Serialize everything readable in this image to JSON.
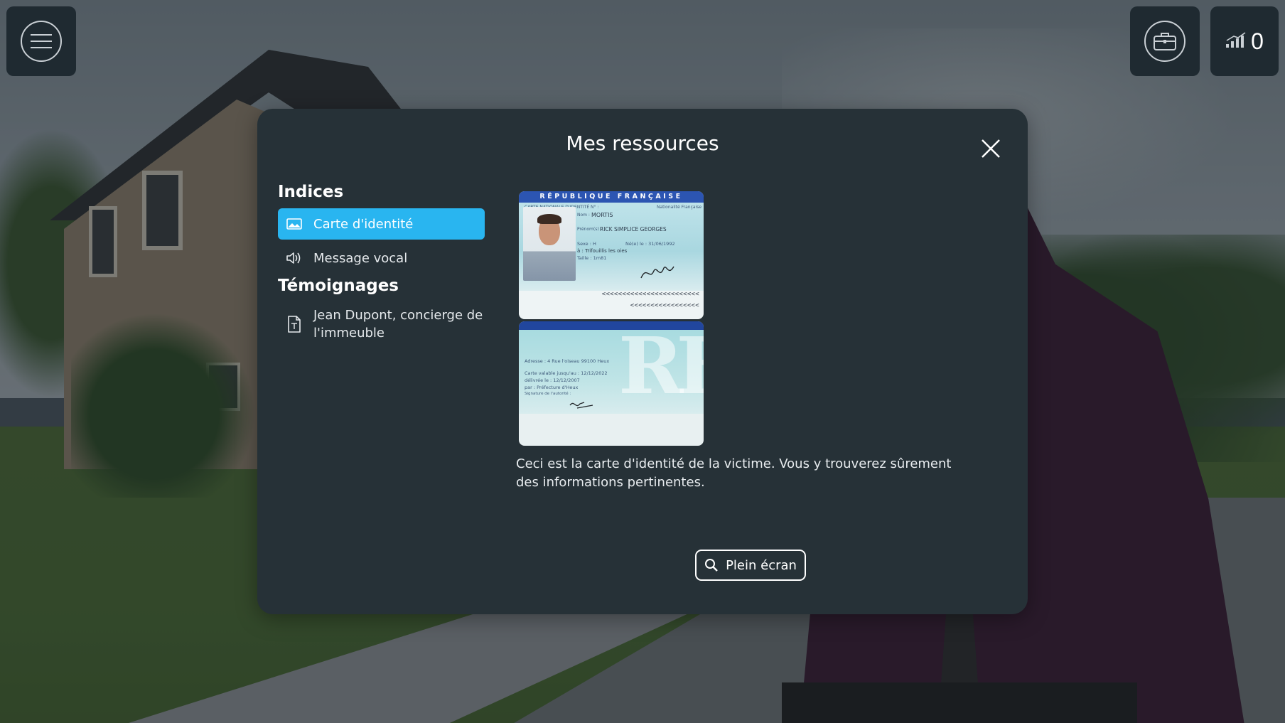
{
  "hud": {
    "score": "0"
  },
  "modal": {
    "title": "Mes ressources",
    "sections": {
      "indices": {
        "title": "Indices",
        "items": [
          {
            "label": "Carte d'identité",
            "icon": "image-icon"
          },
          {
            "label": "Message vocal",
            "icon": "speaker-icon"
          }
        ]
      },
      "temoignages": {
        "title": "Témoignages",
        "items": [
          {
            "label": "Jean Dupont, concierge de l'immeuble",
            "icon": "document-icon"
          }
        ]
      }
    },
    "card": {
      "front": {
        "header": "RÉPUBLIQUE FRANÇAISE",
        "subheader": "CARTE NATIONALE D'IDENTITÉ N° :",
        "nationality": "Nationalité Française",
        "nom_label": "Nom :",
        "nom": "MORTIS",
        "prenoms_label": "Prénom(s) :",
        "prenoms": "RICK SIMPLICE GEORGES",
        "sexe_label": "Sexe : H",
        "ne_label": "Né(e) le : 31/06/1992",
        "lieu": "à : Trifouillis les oies",
        "taille": "Taille : 1m81",
        "mrz1": "<<<<<<<<<<<<<<<<<<<<<<<<",
        "mrz2": "<<<<<<<<<<<<<<<<<"
      },
      "back": {
        "adresse": "Adresse : 4 Rue l'oiseau 99100 Heux",
        "validite": "Carte valable jusqu'au : 12/12/2022",
        "delivree": "délivrée le : 12/12/2007",
        "par": "par : Préfecture d'Heux",
        "signature": "Signature de l'autorité :",
        "logo": "RF"
      }
    },
    "description": "Ceci est la carte d'identité de la victime. Vous y trouverez sûrement des informations pertinentes.",
    "fullscreen_label": "Plein écran"
  },
  "colors": {
    "modal_bg": "#263137",
    "active_item": "#29b5f0",
    "hud_bg": "#1f2a31"
  }
}
